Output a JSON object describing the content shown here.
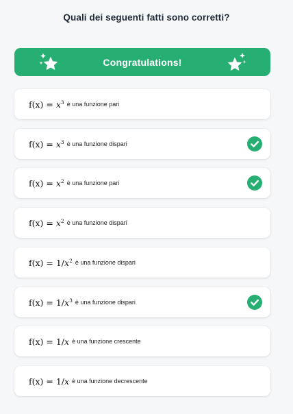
{
  "question": {
    "title": "Quali dei seguenti fatti sono corretti?"
  },
  "banner": {
    "text": "Congratulations!",
    "icon": "sparkle-star-icon",
    "color": "#27ae73"
  },
  "colors": {
    "accent": "#27ae73",
    "card": "#ffffff",
    "background": "#f6f7f9"
  },
  "options": [
    {
      "formula": {
        "prefix": "f(x) = ",
        "body": "x",
        "exp": "3"
      },
      "desc": "è una funzione pari",
      "correct": false
    },
    {
      "formula": {
        "prefix": "f(x) = ",
        "body": "x",
        "exp": "3"
      },
      "desc": "è una funzione dispari",
      "correct": true
    },
    {
      "formula": {
        "prefix": "f(x) = ",
        "body": "x",
        "exp": "2"
      },
      "desc": "è una funzione pari",
      "correct": true
    },
    {
      "formula": {
        "prefix": "f(x) = ",
        "body": "x",
        "exp": "2"
      },
      "desc": "è una funzione dispari",
      "correct": false
    },
    {
      "formula": {
        "prefix": "f(x) = 1/",
        "body": "x",
        "exp": "2"
      },
      "desc": "è una funzione dispari",
      "correct": false
    },
    {
      "formula": {
        "prefix": "f(x) = 1/",
        "body": "x",
        "exp": "3"
      },
      "desc": "è una funzione dispari",
      "correct": true
    },
    {
      "formula": {
        "prefix": "f(x) = 1/",
        "body": "x",
        "exp": ""
      },
      "desc": "è una funzione crescente",
      "correct": false
    },
    {
      "formula": {
        "prefix": "f(x) = 1/",
        "body": "x",
        "exp": ""
      },
      "desc": "è una funzione decrescente",
      "correct": false
    }
  ]
}
